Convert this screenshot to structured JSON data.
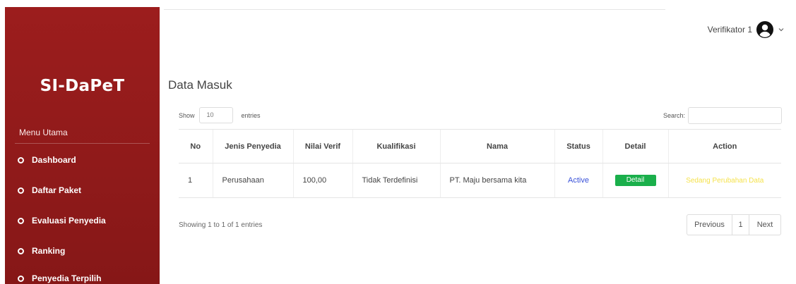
{
  "brand": "SI-DaPeT",
  "sidebar": {
    "heading": "Menu Utama",
    "items": [
      {
        "label": "Dashboard"
      },
      {
        "label": "Daftar Paket"
      },
      {
        "label": "Evaluasi Penyedia"
      },
      {
        "label": "Ranking"
      },
      {
        "label": "Penyedia Terpilih"
      }
    ]
  },
  "user": {
    "name": "Verifikator 1",
    "avatar_icon": "user-circle-icon",
    "dropdown_icon": "chevron-down-icon"
  },
  "page": {
    "title": "Data Masuk"
  },
  "table_controls": {
    "show_label": "Show",
    "entries_value": "10",
    "entries_label": "entries",
    "search_label": "Search:",
    "search_value": ""
  },
  "table": {
    "headers": [
      "No",
      "Jenis Penyedia",
      "Nilai Verif",
      "Kualifikasi",
      "Nama",
      "Status",
      "Detail",
      "Action"
    ],
    "rows": [
      {
        "no": "1",
        "jenis": "Perusahaan",
        "nilai": "100,00",
        "kualifikasi": "Tidak Terdefinisi",
        "nama": "PT. Maju bersama kita",
        "status": "Active",
        "detail": "Detail",
        "action": "Sedang Perubahan Data"
      }
    ]
  },
  "footer": {
    "info": "Showing 1 to 1 of 1 entries",
    "previous": "Previous",
    "page": "1",
    "next": "Next"
  },
  "colors": {
    "sidebar": "#9c1d1d",
    "status_active": "#3a52d9",
    "detail_button": "#1aaf4b",
    "action_text": "#f5e24c"
  }
}
